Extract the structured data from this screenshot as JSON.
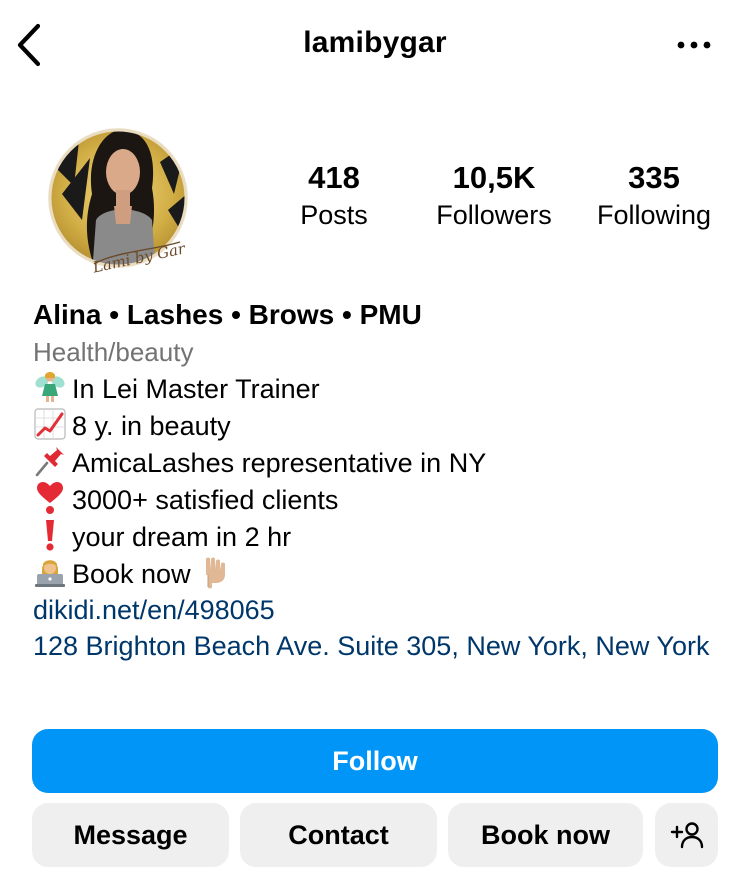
{
  "header": {
    "back_icon": "chevron-left-icon",
    "username": "lamibygar",
    "more_icon": "more-horizontal-icon"
  },
  "avatar": {
    "logo_text": "Lami by Gar",
    "colors": {
      "gold": "#c9a640",
      "dark": "#1a1a1a"
    }
  },
  "stats": {
    "posts": {
      "value": "418",
      "label": "Posts"
    },
    "followers": {
      "value": "10,5K",
      "label": "Followers"
    },
    "following": {
      "value": "335",
      "label": "Following"
    }
  },
  "bio": {
    "name": "Alina • Lashes • Brows • PMU",
    "category": "Health/beauty",
    "lines": [
      {
        "icon": "fairy-emoji-icon",
        "text": "In Lei Master Trainer"
      },
      {
        "icon": "chart-increasing-emoji-icon",
        "text": "8 y. in beauty"
      },
      {
        "icon": "pushpin-emoji-icon",
        "text": "AmicaLashes representative in NY"
      },
      {
        "icon": "heart-exclamation-emoji-icon",
        "text": "3000+ satisfied clients"
      },
      {
        "icon": "exclamation-emoji-icon",
        "text": "your dream in 2 hr"
      },
      {
        "icon": "technologist-emoji-icon",
        "text": "Book now",
        "trailing_icon": "pointing-down-emoji-icon"
      }
    ],
    "link": "dikidi.net/en/498065",
    "address": "128 Brighton Beach Ave. Suite 305, New York, New York"
  },
  "actions": {
    "follow": "Follow",
    "message": "Message",
    "contact": "Contact",
    "book_now": "Book now",
    "add_user_icon": "add-person-icon"
  },
  "colors": {
    "primary": "#0095f6",
    "link": "#00376b",
    "secondary_text": "#737373",
    "secondary_button": "#efefef"
  }
}
